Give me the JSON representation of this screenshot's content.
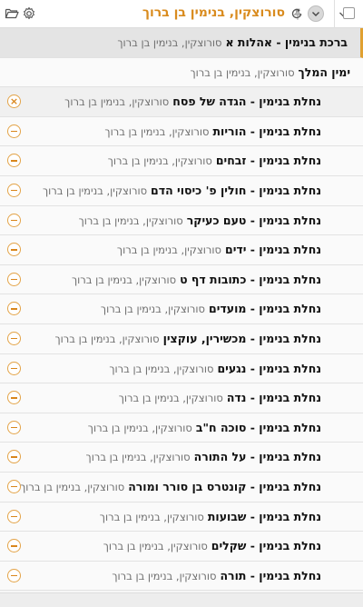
{
  "header": {
    "title": "סורוצקין, בנימין בן ברוך"
  },
  "books": [
    {
      "title": "ברכת בנימין - אהלות א",
      "author": "סורוצקין, בנימין בן ברוך",
      "state": "active"
    },
    {
      "title": "ימין המלך",
      "author": "סורוצקין, בנימין בן ברוך",
      "state": "normal"
    },
    {
      "title": "נחלת בנימין - הגדה של פסח",
      "author": "סורוצקין, בנימין בן ברוך",
      "state": "hover"
    },
    {
      "title": "נחלת בנימין - הוריות",
      "author": "סורוצקין, בנימין בן ברוך",
      "state": "child"
    },
    {
      "title": "נחלת בנימין - זבחים",
      "author": "סורוצקין, בנימין בן ברוך",
      "state": "child"
    },
    {
      "title": "נחלת בנימין - חולין פ' כיסוי הדם",
      "author": "סורוצקין, בנימין בן ברוך",
      "state": "child"
    },
    {
      "title": "נחלת בנימין - טעם כעיקר",
      "author": "סורוצקין, בנימין בן ברוך",
      "state": "child"
    },
    {
      "title": "נחלת בנימין - ידים",
      "author": "סורוצקין, בנימין בן ברוך",
      "state": "child"
    },
    {
      "title": "נחלת בנימין - כתובות דף ט",
      "author": "סורוצקין, בנימין בן ברוך",
      "state": "child"
    },
    {
      "title": "נחלת בנימין - מועדים",
      "author": "סורוצקין, בנימין בן ברוך",
      "state": "child"
    },
    {
      "title": "נחלת בנימין - מכשירין, עוקצין",
      "author": "סורוצקין, בנימין בן ברוך",
      "state": "child"
    },
    {
      "title": "נחלת בנימין - נגעים",
      "author": "סורוצקין, בנימין בן ברוך",
      "state": "child"
    },
    {
      "title": "נחלת בנימין - נדה",
      "author": "סורוצקין, בנימין בן ברוך",
      "state": "child"
    },
    {
      "title": "נחלת בנימין - סוכה ח\"ב",
      "author": "סורוצקין, בנימין בן ברוך",
      "state": "child"
    },
    {
      "title": "נחלת בנימין - על התורה",
      "author": "סורוצקין, בנימין בן ברוך",
      "state": "child"
    },
    {
      "title": "נחלת בנימין - קונטרס בן סורר ומורה",
      "author": "סורוצקין, בנימין בן ברוך",
      "state": "child"
    },
    {
      "title": "נחלת בנימין - שבועות",
      "author": "סורוצקין, בנימין בן ברוך",
      "state": "child"
    },
    {
      "title": "נחלת בנימין - שקלים",
      "author": "סורוצקין, בנימין בן ברוך",
      "state": "child"
    },
    {
      "title": "נחלת בנימין - תורה",
      "author": "סורוצקין, בנימין בן ברוך",
      "state": "child"
    }
  ],
  "icons": {
    "open": "folder-open-icon",
    "settings": "gear-icon",
    "pin": "pin-icon",
    "refresh": "refresh-icon",
    "collapse": "chevron-down-icon",
    "remove": "minus-circle-icon",
    "close": "close-icon"
  },
  "colors": {
    "accent": "#d98b1e",
    "active_bar": "#e0a030"
  }
}
